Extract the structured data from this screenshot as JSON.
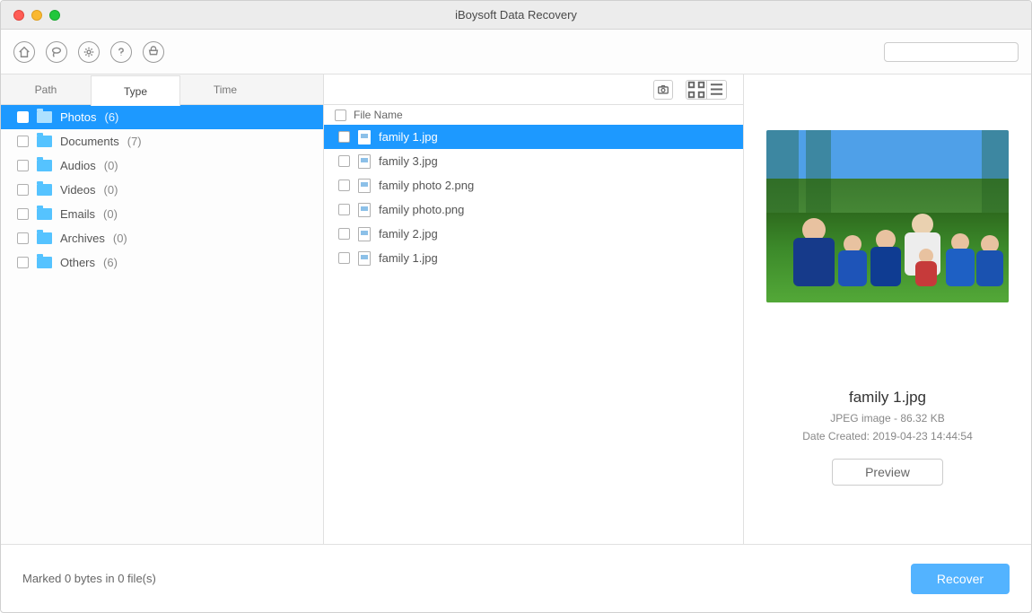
{
  "window": {
    "title": "iBoysoft Data Recovery"
  },
  "toolbar": {
    "icons": [
      "home-icon",
      "lasso-icon",
      "gear-icon",
      "help-icon",
      "cart-icon"
    ],
    "search_placeholder": "",
    "search_value": ""
  },
  "sidebar": {
    "tabs": [
      {
        "label": "Path",
        "active": false
      },
      {
        "label": "Type",
        "active": true
      },
      {
        "label": "Time",
        "active": false
      }
    ],
    "categories": [
      {
        "name": "Photos",
        "count": 6,
        "selected": true
      },
      {
        "name": "Documents",
        "count": 7,
        "selected": false
      },
      {
        "name": "Audios",
        "count": 0,
        "selected": false
      },
      {
        "name": "Videos",
        "count": 0,
        "selected": false
      },
      {
        "name": "Emails",
        "count": 0,
        "selected": false
      },
      {
        "name": "Archives",
        "count": 0,
        "selected": false
      },
      {
        "name": "Others",
        "count": 6,
        "selected": false
      }
    ]
  },
  "filelist": {
    "column_header": "File Name",
    "files": [
      {
        "name": "family 1.jpg",
        "selected": true
      },
      {
        "name": "family 3.jpg",
        "selected": false
      },
      {
        "name": "family photo 2.png",
        "selected": false
      },
      {
        "name": "family photo.png",
        "selected": false
      },
      {
        "name": "family 2.jpg",
        "selected": false
      },
      {
        "name": "family 1.jpg",
        "selected": false
      }
    ]
  },
  "preview": {
    "filename": "family 1.jpg",
    "type": "JPEG image",
    "size": "86.32 KB",
    "date_label": "Date Created:",
    "date": "2019-04-23 14:44:54",
    "button": "Preview"
  },
  "footer": {
    "status": "Marked 0 bytes in 0 file(s)",
    "recover": "Recover"
  }
}
